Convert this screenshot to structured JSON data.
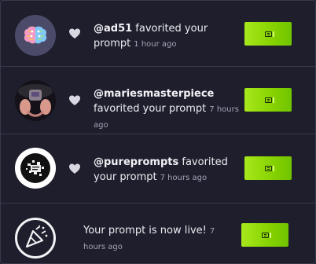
{
  "notifications": [
    {
      "avatar_icon": "brain-icon",
      "liked": true,
      "user": "@ad51",
      "message": " favorited your prompt",
      "time": "1 hour ago"
    },
    {
      "avatar_icon": "mariesmasterpiece-avatar",
      "liked": true,
      "user": "@mariesmasterpiece",
      "message": " favorited your prompt",
      "time": "7 hours ago"
    },
    {
      "avatar_icon": "pureprompts-avatar",
      "liked": true,
      "user": "@pureprompts",
      "message": " favorited your prompt",
      "time": "7 hours ago"
    },
    {
      "avatar_icon": "party-popper-icon",
      "liked": false,
      "user": "",
      "message": "Your prompt is now live!",
      "time": "7 hours ago"
    }
  ],
  "colors": {
    "background": "#1f1e2c",
    "thumbnail_accent": "#8fd400",
    "divider": "#3a394b"
  }
}
